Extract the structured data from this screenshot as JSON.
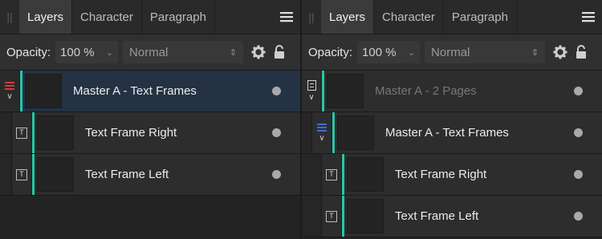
{
  "colors": {
    "accent": "#29c6a7",
    "selected_row": "#243244",
    "master_red": "#d23b3b",
    "master_blue": "#3a6fd6"
  },
  "panels": [
    {
      "tabs": [
        "Layers",
        "Character",
        "Paragraph"
      ],
      "opacity_label": "Opacity:",
      "opacity_value": "100 %",
      "blend_mode": "Normal",
      "layers": [
        {
          "name": "Master A - Text Frames",
          "icon": "master-red-icon",
          "selected": true
        },
        {
          "name": "Text Frame Right",
          "icon": "text-frame-icon"
        },
        {
          "name": "Text Frame Left",
          "icon": "text-frame-icon"
        }
      ]
    },
    {
      "tabs": [
        "Layers",
        "Character",
        "Paragraph"
      ],
      "opacity_label": "Opacity:",
      "opacity_value": "100 %",
      "blend_mode": "Normal",
      "layers": [
        {
          "name": "Master A - 2 Pages",
          "icon": "page-icon",
          "dimmed": true
        },
        {
          "name": "Master A - Text Frames",
          "icon": "master-blue-icon"
        },
        {
          "name": "Text Frame Right",
          "icon": "text-frame-icon"
        },
        {
          "name": "Text Frame Left",
          "icon": "text-frame-icon"
        }
      ]
    }
  ],
  "icons": {
    "text_frame_glyph": "T",
    "chevron": "∨"
  }
}
